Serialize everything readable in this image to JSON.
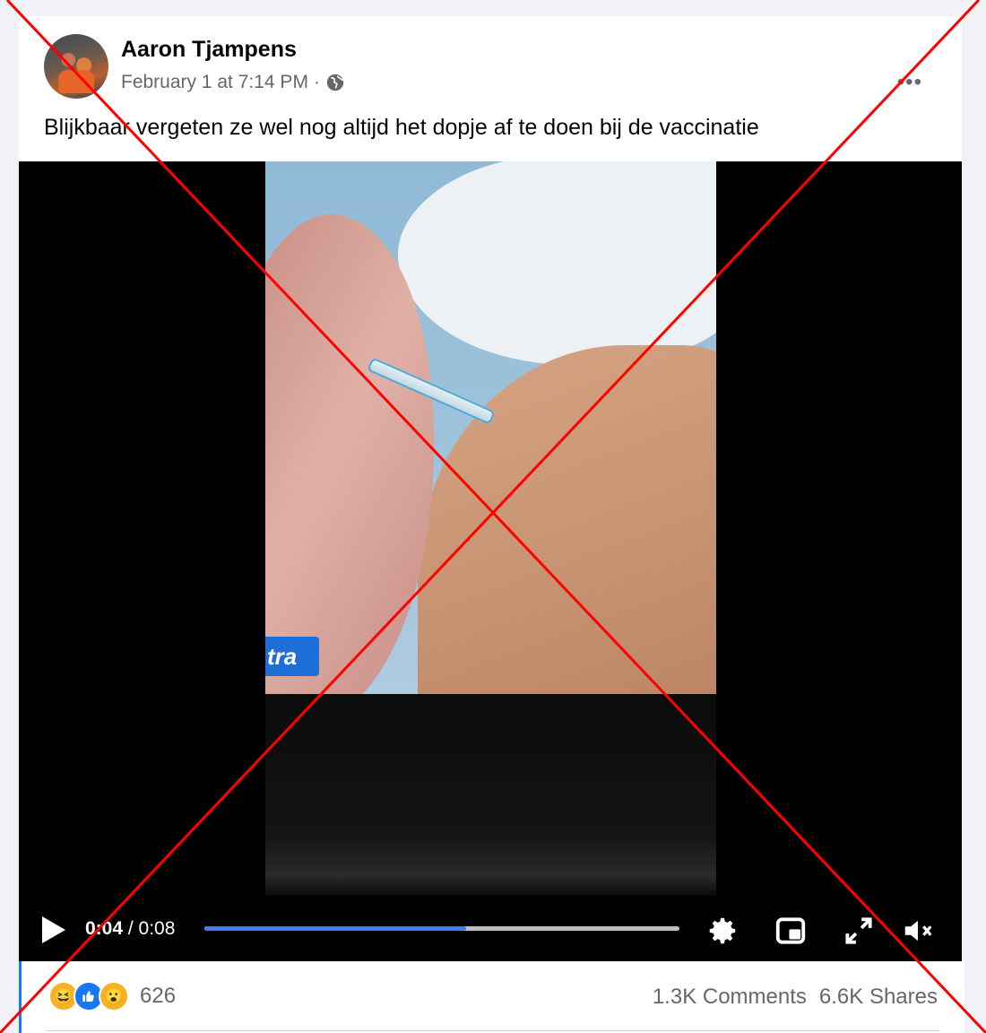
{
  "post": {
    "author": "Aaron Tjampens",
    "date": "February 1 at 7:14 PM",
    "separator": "·",
    "text": "Blijkbaar vergeten ze wel nog altijd het dopje af te doen bij de vaccinatie",
    "more_label": "•••"
  },
  "video": {
    "overlay_badge": "tra",
    "current_time": "0:04",
    "duration": "/ 0:08",
    "progress": 0.55
  },
  "footer": {
    "reaction_count": "626",
    "comments": "1.3K Comments",
    "shares": "6.6K Shares",
    "reactions": [
      "haha",
      "like",
      "wow"
    ]
  },
  "colors": {
    "accent": "#1877f2",
    "progress_fill": "#3d7df3",
    "cross": "#ff0000"
  }
}
